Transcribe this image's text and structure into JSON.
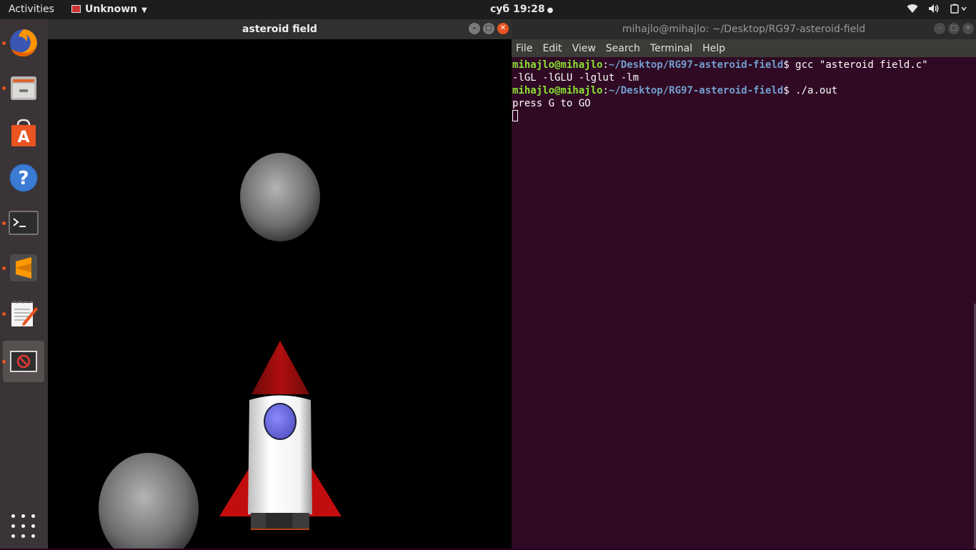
{
  "topbar": {
    "activities": "Activities",
    "app_menu": "Unknown",
    "clock": "суб 19:28",
    "tray_icons": [
      "wifi-icon",
      "volume-icon",
      "system-menu-icon"
    ]
  },
  "dock": {
    "items": [
      "firefox-icon",
      "files-icon",
      "software-center-icon",
      "help-icon",
      "terminal-icon",
      "sublime-text-icon",
      "text-editor-icon",
      "unknown-app-icon"
    ],
    "show_apps": "apps-grid-icon"
  },
  "game_window": {
    "title": "asteroid field"
  },
  "terminal": {
    "title": "mihajlo@mihajlo: ~/Desktop/RG97-asteroid-field",
    "menu": [
      "File",
      "Edit",
      "View",
      "Search",
      "Terminal",
      "Help"
    ],
    "prompt_user": "mihajlo@mihajlo",
    "prompt_sep": ":",
    "prompt_path": "~/Desktop/RG97-asteroid-field",
    "prompt_end": "$ ",
    "cmd1": "gcc \"asteroid field.c\"",
    "cmd1_cont": "-lGL -lGLU -lglut -lm",
    "cmd2": "./a.out",
    "output1": "press G to GO"
  },
  "colors": {
    "terminal_bg": "#300a24",
    "prompt_user": "#8ae234",
    "prompt_path": "#729fcf",
    "accent": "#e95420"
  }
}
